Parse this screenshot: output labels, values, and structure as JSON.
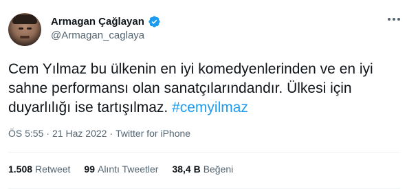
{
  "user": {
    "display_name": "Armagan Çağlayan",
    "handle": "@Armagan_caglaya",
    "verified_color": "#1d9bf0"
  },
  "tweet": {
    "text_before": "Cem Yılmaz bu ülkenin en iyi komedyenlerinden ve en iyi sahne performansı olan sanatçılarındandır. Ülkesi için duyarlılığı ise tartışılmaz. ",
    "hashtag": "#cemyilmaz",
    "time": "ÖS 5:55",
    "sep1": "·",
    "date": "21 Haz 2022",
    "sep2": "·",
    "source": "Twitter for iPhone"
  },
  "stats": {
    "retweets_count": "1.508",
    "retweets_label": "Retweet",
    "quotes_count": "99",
    "quotes_label": "Alıntı Tweetler",
    "likes_count": "38,4 B",
    "likes_label": "Beğeni"
  },
  "icons": {
    "verified": "verified-badge-icon",
    "more": "more-options-icon"
  }
}
